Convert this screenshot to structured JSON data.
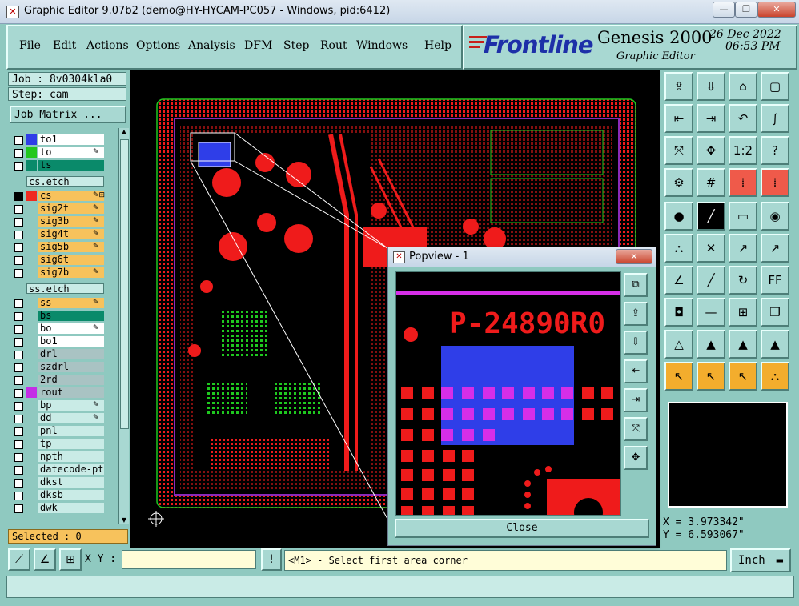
{
  "window": {
    "title": "Graphic Editor 9.07b2 (demo@HY-HYCAM-PC057 - Windows, pid:6412)",
    "min_label": "—",
    "max_label": "❐",
    "close_label": "✕"
  },
  "menu": [
    {
      "label": "File"
    },
    {
      "label": "Edit"
    },
    {
      "label": "Actions"
    },
    {
      "label": "Options"
    },
    {
      "label": "Analysis"
    },
    {
      "label": "DFM"
    },
    {
      "label": "Step"
    },
    {
      "label": "Rout"
    },
    {
      "label": "Windows"
    },
    {
      "label": "Help"
    }
  ],
  "brand": {
    "logo": "Frontline",
    "product": "Genesis 2000",
    "subtitle": "Graphic Editor",
    "date": "26 Dec 2022",
    "time": "06:53 PM"
  },
  "job": {
    "job_line": "Job : 8v0304kla0",
    "step_line": "Step: cam",
    "job_matrix": "Job Matrix ..."
  },
  "layers": [
    {
      "name": "to1",
      "color": "#2f3ee8",
      "bg": "#ffffff"
    },
    {
      "name": "to",
      "color": "#23c81e",
      "bg": "#ffffff",
      "edit": "✎"
    },
    {
      "name": "ts",
      "color": "#0a8a6a",
      "bg": "#0a8a6a"
    },
    {
      "name": "cs.etch",
      "section": true
    },
    {
      "name": "cs",
      "color": "#ef2b20",
      "bg": "#f7c25c",
      "edit": "✎⊞",
      "selected": true
    },
    {
      "name": "sig2t",
      "bg": "#f7c25c",
      "edit": "✎"
    },
    {
      "name": "sig3b",
      "bg": "#f7c25c",
      "edit": "✎"
    },
    {
      "name": "sig4t",
      "bg": "#f7c25c",
      "edit": "✎"
    },
    {
      "name": "sig5b",
      "bg": "#f7c25c",
      "edit": "✎"
    },
    {
      "name": "sig6t",
      "bg": "#f7c25c"
    },
    {
      "name": "sig7b",
      "bg": "#f7c25c",
      "edit": "✎"
    },
    {
      "name": "ss.etch",
      "section": true
    },
    {
      "name": "ss",
      "bg": "#f7c25c",
      "edit": "✎"
    },
    {
      "name": "bs",
      "bg": "#0a8a6a"
    },
    {
      "name": "bo",
      "bg": "#ffffff",
      "edit": "✎"
    },
    {
      "name": "bo1",
      "bg": "#ffffff"
    },
    {
      "name": "drl",
      "bg": "#a9c3c3"
    },
    {
      "name": "szdrl",
      "bg": "#a9c3c3"
    },
    {
      "name": "2rd",
      "bg": "#a9c3c3"
    },
    {
      "name": "rout",
      "color": "#c42ee6",
      "bg": "#a9c3c3"
    },
    {
      "name": "bp",
      "bg": "#c9ebe6",
      "edit": "✎"
    },
    {
      "name": "dd",
      "bg": "#c9ebe6",
      "edit": "✎"
    },
    {
      "name": "pnl",
      "bg": "#c9ebe6"
    },
    {
      "name": "tp",
      "bg": "#c9ebe6"
    },
    {
      "name": "npth",
      "bg": "#c9ebe6"
    },
    {
      "name": "datecode-ptc",
      "bg": "#c9ebe6"
    },
    {
      "name": "dkst",
      "bg": "#c9ebe6"
    },
    {
      "name": "dksb",
      "bg": "#c9ebe6"
    },
    {
      "name": "dwk",
      "bg": "#c9ebe6"
    }
  ],
  "selected_label": "Selected : 0",
  "coords": {
    "x": "X = 3.973342\"",
    "y": "Y = 6.593067\""
  },
  "command": {
    "xy_label": "X Y :",
    "xy_value": "",
    "bang": "!",
    "prompt": "<M1> - Select first area corner",
    "unit": "Inch"
  },
  "popview": {
    "title": "Popview - 1",
    "close_x": "✕",
    "close_button": "Close",
    "part_text": "P-24890R0"
  },
  "colors": {
    "board_red": "#ef1b1b",
    "board_green": "#1fc81f",
    "board_blue": "#2f3ee8",
    "magenta": "#d62ee8",
    "panel": "#8fc9c0",
    "button": "#a8d8d2"
  }
}
